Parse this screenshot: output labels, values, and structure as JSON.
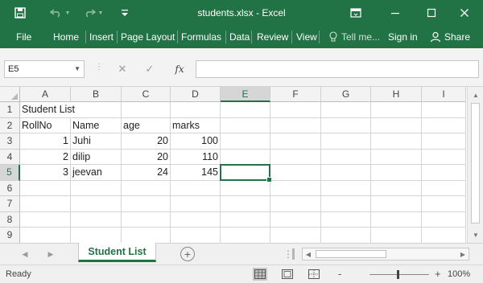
{
  "window": {
    "title": "students.xlsx - Excel",
    "icons": [
      "save-icon",
      "undo-icon",
      "redo-icon",
      "customize-qat-icon",
      "ribbon-display-options-icon",
      "minimize-icon",
      "maximize-icon",
      "close-icon"
    ]
  },
  "ribbon": {
    "tabs": [
      "File",
      "Home",
      "Insert",
      "Page Layout",
      "Formulas",
      "Data",
      "Review",
      "View"
    ],
    "tell_me": "Tell me...",
    "sign_in": "Sign in",
    "share": "Share"
  },
  "formula_bar": {
    "name_box": "E5",
    "fx": "fx",
    "content": ""
  },
  "sheet": {
    "columns": [
      "A",
      "B",
      "C",
      "D",
      "E",
      "F",
      "G",
      "H",
      "I"
    ],
    "row_numbers": [
      "1",
      "2",
      "3",
      "4",
      "5",
      "6",
      "7",
      "8",
      "9"
    ],
    "active_cell": "E5",
    "rows": [
      [
        "Student List",
        "",
        "",
        "",
        "",
        "",
        "",
        "",
        ""
      ],
      [
        "RollNo",
        "Name",
        "age",
        "marks",
        "",
        "",
        "",
        "",
        ""
      ],
      [
        "1",
        "Juhi",
        "20",
        "100",
        "",
        "",
        "",
        "",
        ""
      ],
      [
        "2",
        "dilip",
        "20",
        "110",
        "",
        "",
        "",
        "",
        ""
      ],
      [
        "3",
        "jeevan",
        "24",
        "145",
        "",
        "",
        "",
        "",
        ""
      ],
      [
        "",
        "",
        "",
        "",
        "",
        "",
        "",
        "",
        ""
      ],
      [
        "",
        "",
        "",
        "",
        "",
        "",
        "",
        "",
        ""
      ],
      [
        "",
        "",
        "",
        "",
        "",
        "",
        "",
        "",
        ""
      ],
      [
        "",
        "",
        "",
        "",
        "",
        "",
        "",
        "",
        ""
      ]
    ],
    "numeric_cells": [
      "A3",
      "A4",
      "A5",
      "C3",
      "C4",
      "C5",
      "D3",
      "D4",
      "D5"
    ]
  },
  "sheet_tabs": {
    "tabs": [
      "Student List"
    ],
    "active": "Student List"
  },
  "status_bar": {
    "status": "Ready",
    "zoom": "100%",
    "zoom_out": "-",
    "zoom_in": "+"
  },
  "colors": {
    "accent": "#217346",
    "gridline": "#d4d4d4",
    "header_bg": "#f3f3f3"
  }
}
